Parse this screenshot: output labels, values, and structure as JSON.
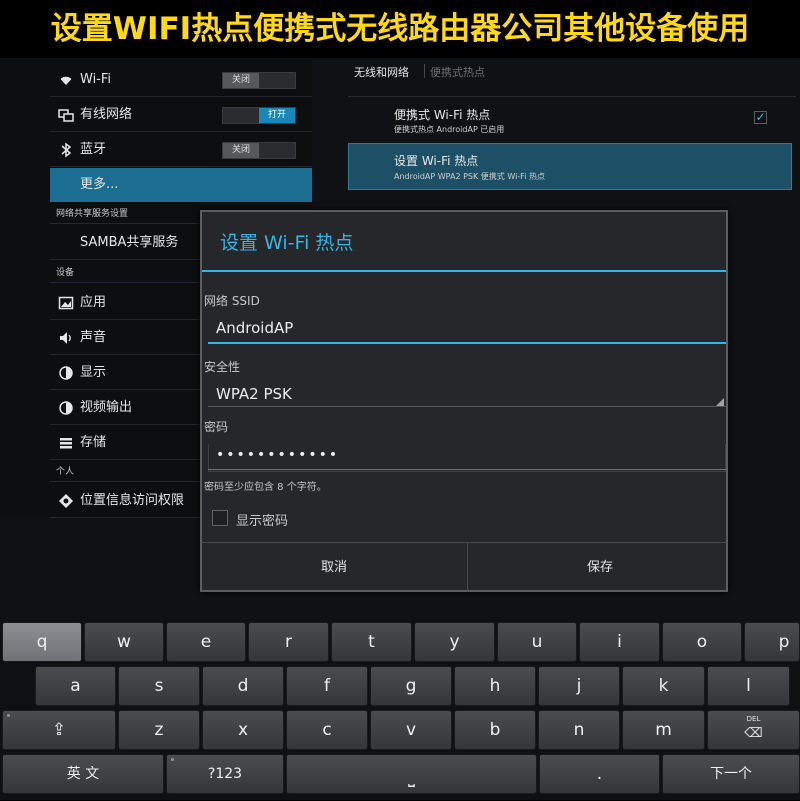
{
  "banner": {
    "text": "设置WIFI热点便携式无线路由器公司其他设备使用"
  },
  "settings_list": {
    "wifi": {
      "label": "Wi-Fi",
      "toggle": "关闭",
      "icon": "wifi-icon"
    },
    "ethernet": {
      "label": "有线网络",
      "toggle": "打开",
      "icon": "ethernet-icon"
    },
    "bluetooth": {
      "label": "蓝牙",
      "toggle": "关闭",
      "icon": "bluetooth-icon"
    },
    "more": {
      "label": "更多..."
    },
    "section_network_share": "网络共享服务设置",
    "samba": {
      "label": "SAMBA共享服务"
    },
    "section_device": "设备",
    "apps": {
      "label": "应用",
      "icon": "apps-icon"
    },
    "sound": {
      "label": "声音",
      "icon": "sound-icon"
    },
    "display": {
      "label": "显示",
      "icon": "display-icon"
    },
    "video_out": {
      "label": "视频输出",
      "icon": "video-output-icon"
    },
    "storage": {
      "label": "存储",
      "icon": "storage-icon"
    },
    "section_personal": "个人",
    "location": {
      "label": "位置信息访问权限",
      "icon": "location-icon"
    }
  },
  "detail": {
    "breadcrumb_1": "无线和网络",
    "breadcrumb_2": "便携式热点",
    "hotspot": {
      "title": "便携式 Wi-Fi 热点",
      "subtitle": "便携式热点 AndroidAP 已启用",
      "checked": true
    },
    "setup": {
      "title": "设置 Wi-Fi 热点",
      "subtitle": "AndroidAP WPA2 PSK 便携式 Wi-Fi 热点"
    }
  },
  "dialog": {
    "title": "设置 Wi-Fi 热点",
    "ssid_label": "网络 SSID",
    "ssid_value": "AndroidAP",
    "security_label": "安全性",
    "security_value": "WPA2 PSK",
    "password_label": "密码",
    "password_value": "••••••••••••",
    "password_hint": "密码至少应包含 8 个字符。",
    "show_password_label": "显示密码",
    "cancel": "取消",
    "save": "保存"
  },
  "keyboard": {
    "row1": [
      "q",
      "w",
      "e",
      "r",
      "t",
      "y",
      "u",
      "i",
      "o",
      "p"
    ],
    "row2": [
      "a",
      "s",
      "d",
      "f",
      "g",
      "h",
      "j",
      "k",
      "l"
    ],
    "row3": [
      "z",
      "x",
      "c",
      "v",
      "b",
      "n",
      "m"
    ],
    "shift": "⇪",
    "delete_label": "DEL",
    "delete_symbol": "⌫",
    "lang": "英 文",
    "symbols": "?123",
    "space": "⎵",
    "period": ".",
    "next": "下一个"
  },
  "colors": {
    "accent": "#33b5e5",
    "banner_text": "#ffd81a",
    "selected_row": "#1b6e91"
  }
}
